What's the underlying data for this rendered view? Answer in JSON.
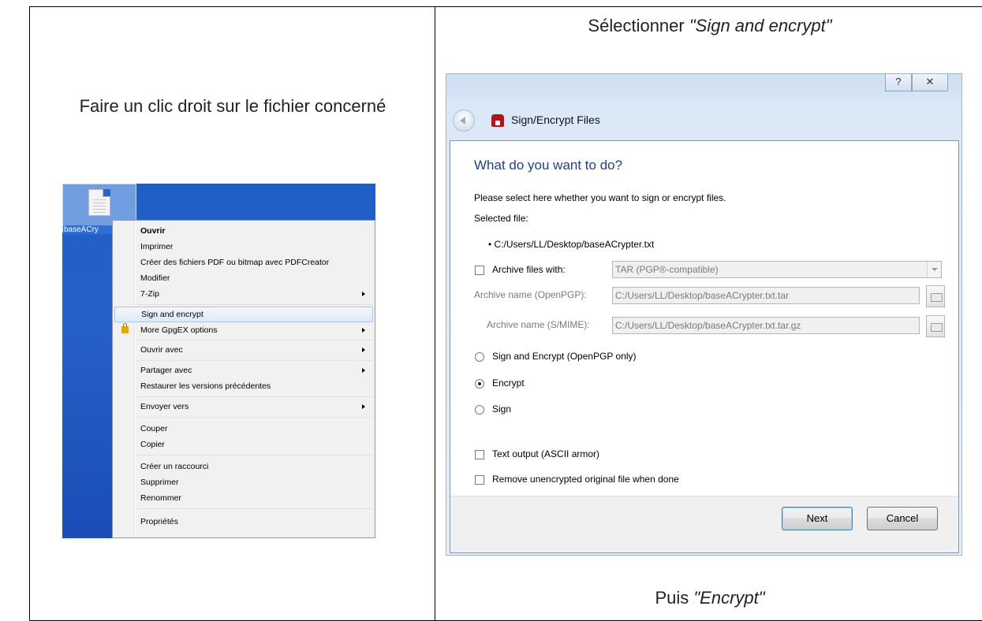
{
  "captions": {
    "left": "Faire un clic droit sur le fichier concerné",
    "right_prefix": "Sélectionner ",
    "right_emph": "\"Sign and encrypt\"",
    "bottom_prefix": "Puis ",
    "bottom_emph": "\"Encrypt\""
  },
  "explorer": {
    "file_label": "baseACry",
    "file_icon": "text-file-icon",
    "desktop_color": "#2560c8"
  },
  "context_menu": {
    "items": [
      {
        "label": "Ouvrir",
        "bold": true
      },
      {
        "label": "Imprimer"
      },
      {
        "label": "Créer des fichiers PDF ou bitmap avec PDFCreator"
      },
      {
        "label": "Modifier"
      },
      {
        "label": "7-Zip",
        "submenu": true
      },
      {
        "label": "Sign and encrypt",
        "highlighted": true
      },
      {
        "label": "More GpgEX options",
        "submenu": true,
        "icon": "lock-icon"
      },
      {
        "label": "Ouvrir avec",
        "submenu": true
      },
      {
        "label": "Partager avec",
        "submenu": true
      },
      {
        "label": "Restaurer les versions précédentes"
      },
      {
        "label": "Envoyer vers",
        "submenu": true
      },
      {
        "label": "Couper"
      },
      {
        "label": "Copier"
      },
      {
        "label": "Créer un raccourci"
      },
      {
        "label": "Supprimer"
      },
      {
        "label": "Renommer"
      },
      {
        "label": "Propriétés"
      }
    ]
  },
  "dialog": {
    "help_button": "?",
    "close_button": "✕",
    "title": "Sign/Encrypt Files",
    "heading": "What do you want to do?",
    "intro": "Please select here whether you want to sign or encrypt files.",
    "selected_file_label": "Selected file:",
    "selected_file": "• C:/Users/LL/Desktop/baseACrypter.txt",
    "archive_checkbox_label": "Archive files with:",
    "archive_format": "TAR (PGP®-compatible)",
    "archive_openpgp_label": "Archive name (OpenPGP):",
    "archive_openpgp_value": "C:/Users/LL/Desktop/baseACrypter.txt.tar",
    "archive_smime_label": "Archive name (S/MIME):",
    "archive_smime_value": "C:/Users/LL/Desktop/baseACrypter.txt.tar.gz",
    "options": [
      {
        "label": "Sign and Encrypt (OpenPGP only)",
        "selected": false
      },
      {
        "label": "Encrypt",
        "selected": true
      },
      {
        "label": "Sign",
        "selected": false
      }
    ],
    "text_output_label": "Text output (ASCII armor)",
    "remove_original_label": "Remove unencrypted original file when done",
    "next_button": "Next",
    "cancel_button": "Cancel",
    "accent_color": "#1f3f8e"
  }
}
